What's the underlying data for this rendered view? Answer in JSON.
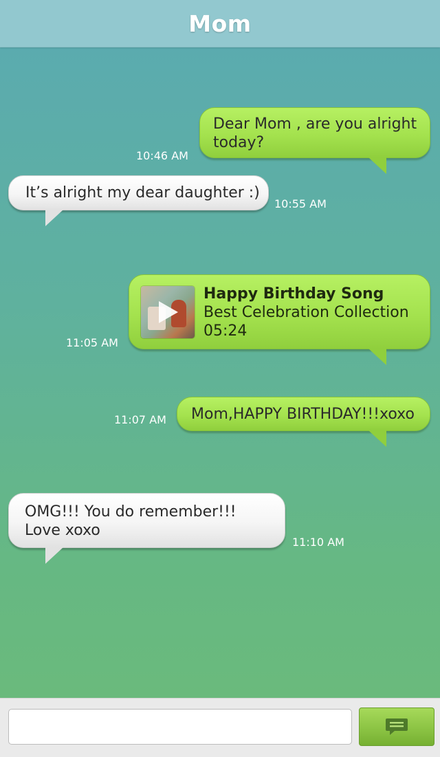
{
  "header": {
    "title": "Mom"
  },
  "messages": [
    {
      "direction": "out",
      "text": "Dear Mom , are you alright today?",
      "time": "10:46 AM"
    },
    {
      "direction": "in",
      "text": "It’s alright my dear daughter :)",
      "time": "10:55 AM"
    },
    {
      "direction": "out",
      "type": "media",
      "media": {
        "title": "Happy Birthday Song",
        "subtitle": "Best Celebration Collection",
        "duration": "05:24"
      },
      "time": "11:05 AM"
    },
    {
      "direction": "out",
      "text": "Mom,HAPPY BIRTHDAY!!!xoxo",
      "time": "11:07 AM"
    },
    {
      "direction": "in",
      "lines": [
        "OMG!!! You do remember!!!",
        "Love xoxo"
      ],
      "time": "11:10 AM"
    }
  ],
  "composer": {
    "placeholder": ""
  },
  "icons": {
    "send": "chat-bubble-icon"
  },
  "colors": {
    "outgoing": "#a4e24e",
    "incoming": "#f5f5f5",
    "header": "#92c8cf",
    "accent": "#8cc444"
  }
}
